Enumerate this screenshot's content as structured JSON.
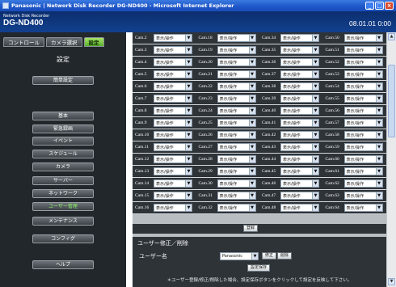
{
  "window": {
    "title": "Panasonic | Network Disk Recorder DG-ND400 - Microsoft Internet Explorer",
    "controls": [
      "_",
      "□",
      "×"
    ]
  },
  "header": {
    "subtitle": "Network Disk Recorder",
    "model": "DG-ND400",
    "clock": "08.01.01  0:00"
  },
  "tabs": [
    {
      "label": "コントロール",
      "active": false
    },
    {
      "label": "カメラ選択",
      "active": false
    },
    {
      "label": "設定",
      "active": true
    }
  ],
  "nav": {
    "title": "設定",
    "items": [
      {
        "label": "簡単設定",
        "selected": false
      },
      {
        "label": "基本",
        "selected": false
      },
      {
        "label": "緊急録画",
        "selected": false
      },
      {
        "label": "イベント",
        "selected": false
      },
      {
        "label": "スケジュール",
        "selected": false
      },
      {
        "label": "カメラ",
        "selected": false
      },
      {
        "label": "サーバー",
        "selected": false
      },
      {
        "label": "ネットワーク",
        "selected": false
      },
      {
        "label": "ユーザー管理",
        "selected": true
      },
      {
        "label": "メンテナンス",
        "selected": false
      },
      {
        "label": "コンフィグ",
        "selected": false
      },
      {
        "label": "ヘルプ",
        "selected": false
      }
    ]
  },
  "camera_grid": {
    "option": "表示/操作",
    "rows": [
      [
        "Cam.2",
        "Cam.18",
        "Cam.34",
        "Cam.50"
      ],
      [
        "Cam.3",
        "Cam.19",
        "Cam.35",
        "Cam.51"
      ],
      [
        "Cam.4",
        "Cam.20",
        "Cam.36",
        "Cam.52"
      ],
      [
        "Cam.5",
        "Cam.21",
        "Cam.37",
        "Cam.53"
      ],
      [
        "Cam.6",
        "Cam.22",
        "Cam.38",
        "Cam.54"
      ],
      [
        "Cam.7",
        "Cam.23",
        "Cam.39",
        "Cam.55"
      ],
      [
        "Cam.8",
        "Cam.24",
        "Cam.40",
        "Cam.56"
      ],
      [
        "Cam.9",
        "Cam.25",
        "Cam.41",
        "Cam.57"
      ],
      [
        "Cam.10",
        "Cam.26",
        "Cam.42",
        "Cam.58"
      ],
      [
        "Cam.11",
        "Cam.27",
        "Cam.43",
        "Cam.59"
      ],
      [
        "Cam.12",
        "Cam.28",
        "Cam.44",
        "Cam.60"
      ],
      [
        "Cam.13",
        "Cam.29",
        "Cam.45",
        "Cam.61"
      ],
      [
        "Cam.14",
        "Cam.30",
        "Cam.46",
        "Cam.62"
      ],
      [
        "Cam.15",
        "Cam.31",
        "Cam.47",
        "Cam.63"
      ],
      [
        "Cam.16",
        "Cam.32",
        "Cam.48",
        "Cam.64"
      ]
    ]
  },
  "register_button": "登録",
  "user_section": {
    "heading": "ユーザー修正／削除",
    "user_label": "ユーザー名",
    "user_value": "Panasonic",
    "edit_button": "修正",
    "delete_button": "削除",
    "save_button": "設定保存",
    "note": "＊ユーザー登録/修正/削除した場合、設定保存ボタンをクリックして設定を反映して下さい。"
  }
}
